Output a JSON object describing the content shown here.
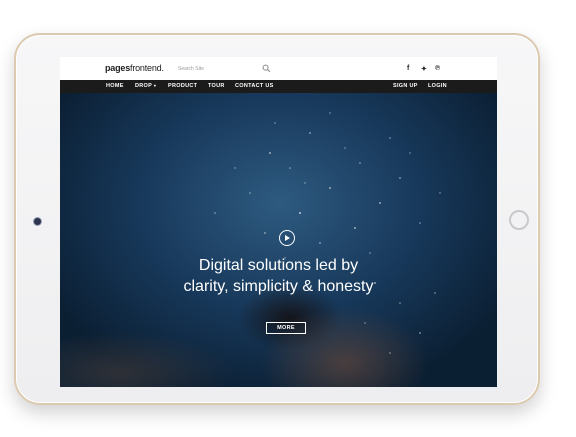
{
  "site": {
    "logo_bold": "pages",
    "logo_rest": "frontend."
  },
  "search": {
    "placeholder": "Search Site",
    "icon": "search-icon"
  },
  "social": {
    "facebook": "f",
    "twitter": "✦",
    "pinterest": "℗"
  },
  "nav": {
    "home": "HOME",
    "drop": "DROP",
    "product": "PRODUCT",
    "tour": "TOUR",
    "contact": "CONTACT US",
    "signup": "SIGN UP",
    "login": "LOGIN"
  },
  "hero": {
    "headline_line1": "Digital solutions led by",
    "headline_line2": "clarity, simplicity & honesty",
    "button_label": "MORE",
    "play_icon": "play-icon"
  },
  "colors": {
    "nav_bg": "#1b1b1b",
    "hero_deep": "#0b1f33",
    "hero_light": "#2e5a80",
    "tablet_frame": "#dccab0"
  }
}
